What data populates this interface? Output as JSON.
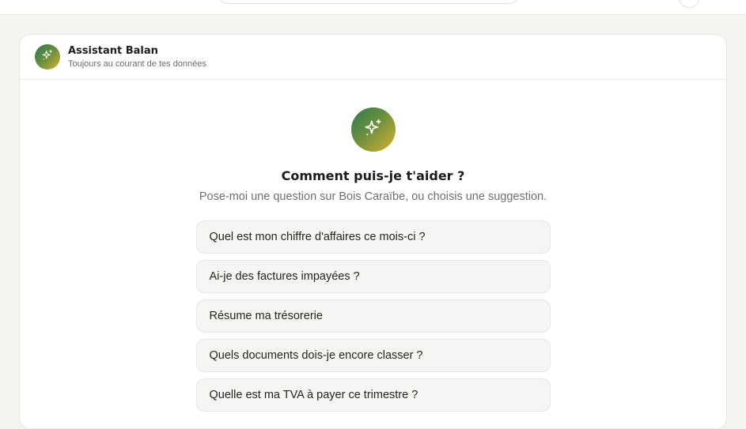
{
  "header": {
    "title": "Assistant Balan",
    "subtitle": "Toujours au courant de tes données"
  },
  "hero": {
    "title": "Comment puis-je t'aider ?",
    "subtitle": "Pose-moi une question sur Bois Caraïbe, ou choisis une suggestion."
  },
  "suggestions": [
    {
      "label": "Quel est mon chiffre d'affaires ce mois-ci ?"
    },
    {
      "label": "Ai-je des factures impayées ?"
    },
    {
      "label": "Résume ma trésorerie"
    },
    {
      "label": "Quels documents dois-je encore classer ?"
    },
    {
      "label": "Quelle est ma TVA à payer ce trimestre ?"
    }
  ],
  "icons": {
    "assistant": "sparkles-icon"
  },
  "colors": {
    "gradient_start": "#2e7a52",
    "gradient_end": "#dcb131",
    "suggestion_bg": "#f5f6f4",
    "page_bg": "#f4f4f1"
  }
}
